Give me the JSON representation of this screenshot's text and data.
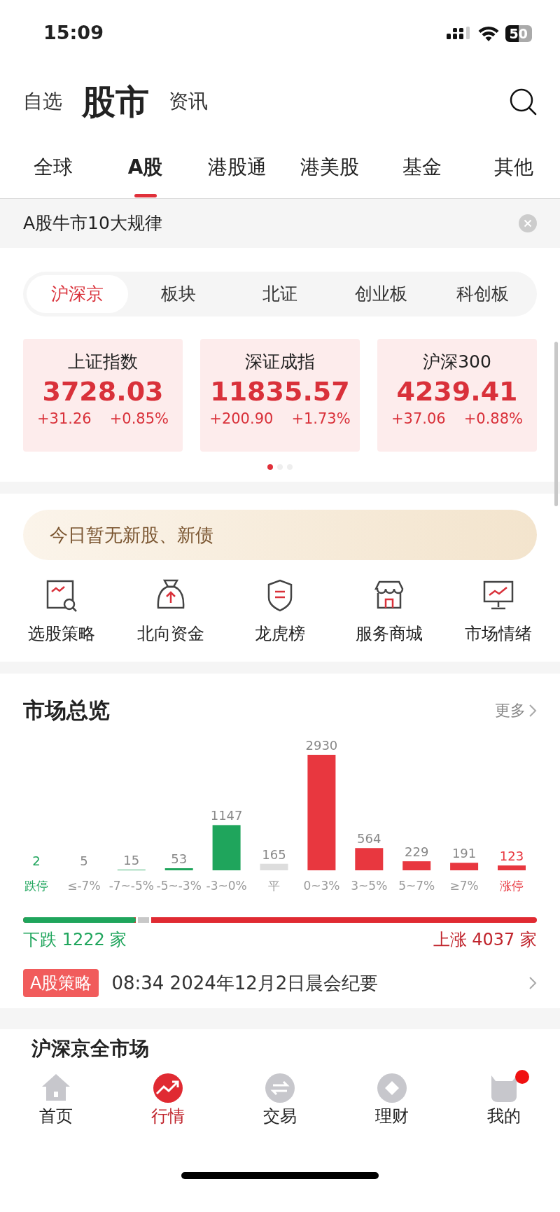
{
  "status_bar": {
    "time": "15:09",
    "battery": "50"
  },
  "header": {
    "items": [
      {
        "label": "自选",
        "selected": false
      },
      {
        "label": "股市",
        "selected": true
      },
      {
        "label": "资讯",
        "selected": false
      }
    ]
  },
  "market_tabs": [
    {
      "label": "全球",
      "selected": false
    },
    {
      "label": "A股",
      "selected": true
    },
    {
      "label": "港股通",
      "selected": false
    },
    {
      "label": "港美股",
      "selected": false
    },
    {
      "label": "基金",
      "selected": false
    },
    {
      "label": "其他",
      "selected": false
    }
  ],
  "notice": {
    "text": "A股牛市10大规律"
  },
  "segments": [
    {
      "label": "沪深京",
      "selected": true
    },
    {
      "label": "板块",
      "selected": false
    },
    {
      "label": "北证",
      "selected": false
    },
    {
      "label": "创业板",
      "selected": false
    },
    {
      "label": "科创板",
      "selected": false
    }
  ],
  "index_cards": [
    {
      "name": "上证指数",
      "value": "3728.03",
      "change": "+31.26",
      "percent": "+0.85%"
    },
    {
      "name": "深证成指",
      "value": "11835.57",
      "change": "+200.90",
      "percent": "+1.73%"
    },
    {
      "name": "沪深300",
      "value": "4239.41",
      "change": "+37.06",
      "percent": "+0.88%"
    }
  ],
  "pager": [
    {
      "selected": true
    },
    {
      "selected": false
    },
    {
      "selected": false
    }
  ],
  "ipo_banner": {
    "text": "今日暂无新股、新债"
  },
  "shortcuts": [
    {
      "kind": "chart",
      "label": "选股策略"
    },
    {
      "kind": "bag",
      "label": "北向资金"
    },
    {
      "kind": "shield",
      "label": "龙虎榜"
    },
    {
      "kind": "shop",
      "label": "服务商城"
    },
    {
      "kind": "monitor",
      "label": "市场情绪"
    }
  ],
  "overview": {
    "title": "市场总览",
    "more": "更多",
    "chart_data": {
      "type": "bar",
      "categories": [
        "跌停",
        "≤-7%",
        "-7~-5%",
        "-5~-3%",
        "-3~0%",
        "平",
        "0~3%",
        "3~5%",
        "5~7%",
        "≥7%",
        "涨停"
      ],
      "data_labels": true,
      "series": [
        {
          "color": "#1fa55c",
          "values": [
            2,
            5,
            15,
            53,
            1147,
            null,
            null,
            null,
            null,
            null,
            null
          ]
        },
        {
          "color": "#dddddd",
          "values": [
            null,
            null,
            null,
            null,
            null,
            165,
            null,
            null,
            null,
            null,
            null
          ]
        },
        {
          "color": "#e8373f",
          "values": [
            null,
            null,
            null,
            null,
            null,
            null,
            2930,
            564,
            229,
            191,
            123
          ]
        }
      ]
    },
    "ratio": {
      "level": 0.22
    },
    "down_text": "下跌 1222 家",
    "up_text": "上涨 4037 家",
    "strategy": {
      "tag": "A股策略",
      "text": "08:34 2024年12月2日晨会纪要"
    }
  },
  "next_section": {
    "title": "沪深京全市场"
  },
  "bottom_nav": [
    {
      "kind": "home",
      "label": "首页",
      "selected": false,
      "badge": false
    },
    {
      "kind": "trend",
      "label": "行情",
      "selected": true,
      "badge": false
    },
    {
      "kind": "trade",
      "label": "交易",
      "selected": false,
      "badge": false
    },
    {
      "kind": "wealth",
      "label": "理财",
      "selected": false,
      "badge": false
    },
    {
      "kind": "me",
      "label": "我的",
      "selected": false,
      "badge": true
    }
  ]
}
